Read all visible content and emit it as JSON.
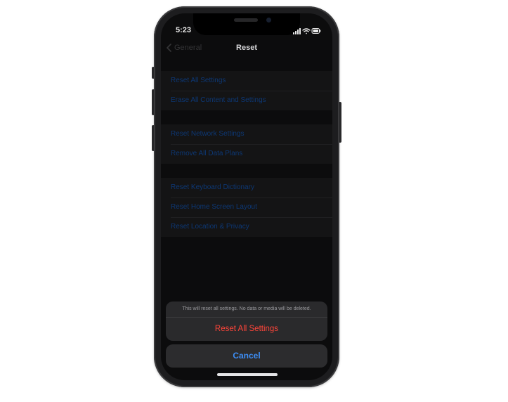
{
  "status_bar": {
    "time": "5:23",
    "icons": [
      "cellular-signal-icon",
      "wifi-icon",
      "battery-icon"
    ]
  },
  "nav": {
    "back_label": "General",
    "title": "Reset"
  },
  "groups": [
    {
      "items": [
        {
          "label": "Reset All Settings"
        },
        {
          "label": "Erase All Content and Settings"
        }
      ]
    },
    {
      "items": [
        {
          "label": "Reset Network Settings"
        },
        {
          "label": "Remove All Data Plans"
        }
      ]
    },
    {
      "items": [
        {
          "label": "Reset Keyboard Dictionary"
        },
        {
          "label": "Reset Home Screen Layout"
        },
        {
          "label": "Reset Location & Privacy"
        }
      ]
    }
  ],
  "action_sheet": {
    "message": "This will reset all settings. No data or media will be deleted.",
    "destructive_label": "Reset All Settings",
    "cancel_label": "Cancel"
  },
  "colors": {
    "accent": "#3d8ef6",
    "destructive": "#ff453a",
    "background": "#0e0e0f"
  }
}
